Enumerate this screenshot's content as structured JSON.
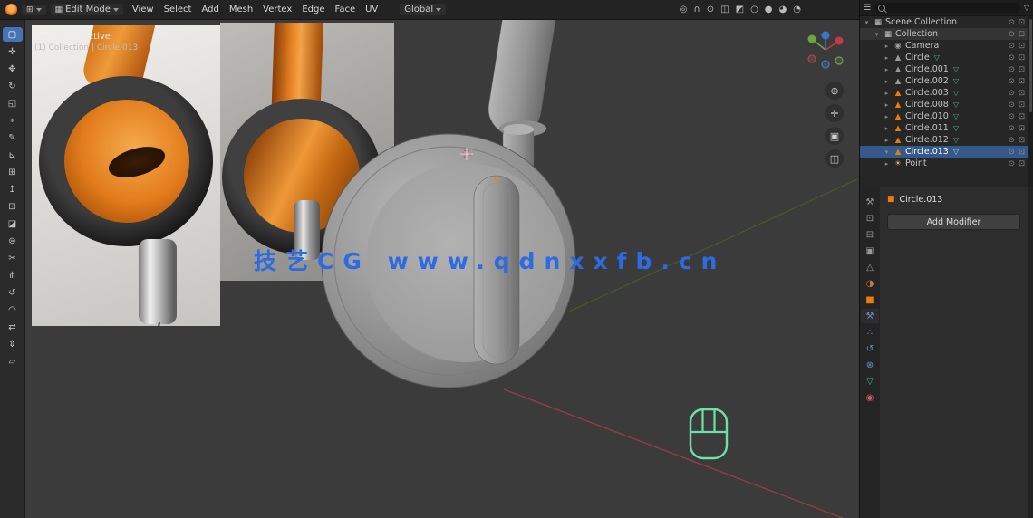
{
  "colors": {
    "accent_blue": "#4772b3",
    "selection_blue": "#35598a",
    "object_orange": "#e87d0d",
    "mesh_teal": "#43b693",
    "watermark_blue": "#2d6be3",
    "mouse_green": "#6fe0ac",
    "axis_red": "#9c3f46",
    "axis_green": "#44622a"
  },
  "header": {
    "mode_label": "Edit Mode",
    "mode_icon_glyph": "▦",
    "editor_icon_glyph": "⊞",
    "menus": [
      {
        "name": "menu-view",
        "label": "View"
      },
      {
        "name": "menu-select",
        "label": "Select"
      },
      {
        "name": "menu-add",
        "label": "Add"
      },
      {
        "name": "menu-mesh",
        "label": "Mesh"
      },
      {
        "name": "menu-vertex",
        "label": "Vertex"
      },
      {
        "name": "menu-edge",
        "label": "Edge"
      },
      {
        "name": "menu-face",
        "label": "Face"
      },
      {
        "name": "menu-uv",
        "label": "UV"
      }
    ],
    "orientation_label": "Global",
    "right_icons": [
      {
        "name": "proportional-editing-icon",
        "glyph": "◎"
      },
      {
        "name": "snap-magnet-icon",
        "glyph": "∩"
      },
      {
        "name": "pivot-point-icon",
        "glyph": "⊙"
      },
      {
        "name": "overlays-icon",
        "glyph": "◫"
      },
      {
        "name": "xray-toggle-icon",
        "glyph": "◩"
      },
      {
        "name": "shading-wireframe-icon",
        "glyph": "○"
      },
      {
        "name": "shading-solid-icon",
        "glyph": "●"
      },
      {
        "name": "shading-material-icon",
        "glyph": "◕"
      },
      {
        "name": "shading-rendered-icon",
        "glyph": "◔"
      }
    ]
  },
  "toolbar": {
    "items": [
      {
        "name": "select-box-tool",
        "glyph": "▢",
        "active": true
      },
      {
        "name": "cursor-tool",
        "glyph": "✛"
      },
      {
        "name": "move-tool",
        "glyph": "✥"
      },
      {
        "name": "rotate-tool",
        "glyph": "↻"
      },
      {
        "name": "scale-tool",
        "glyph": "◱"
      },
      {
        "name": "transform-tool",
        "glyph": "⌖"
      },
      {
        "name": "annotate-tool",
        "glyph": "✎"
      },
      {
        "name": "measure-tool",
        "glyph": "⊾"
      },
      {
        "name": "add-cube-tool",
        "glyph": "⊞"
      },
      {
        "name": "extrude-tool",
        "glyph": "↥"
      },
      {
        "name": "inset-faces-tool",
        "glyph": "⊡"
      },
      {
        "name": "bevel-tool",
        "glyph": "◪"
      },
      {
        "name": "loop-cut-tool",
        "glyph": "⊜"
      },
      {
        "name": "knife-tool",
        "glyph": "✂"
      },
      {
        "name": "poly-build-tool",
        "glyph": "⋔"
      },
      {
        "name": "spin-tool",
        "glyph": "↺"
      },
      {
        "name": "smooth-tool",
        "glyph": "◠"
      },
      {
        "name": "edge-slide-tool",
        "glyph": "⇄"
      },
      {
        "name": "shrink-fatten-tool",
        "glyph": "⇕"
      },
      {
        "name": "shear-tool",
        "glyph": "▱"
      }
    ]
  },
  "viewport": {
    "overlay_line1": "User Perspective",
    "overlay_line2": "(1) Collection | Circle.013",
    "watermark": "技艺CG www.qdnxxfb.cn",
    "nav_icons": [
      {
        "name": "zoom-icon",
        "glyph": "⊕"
      },
      {
        "name": "pan-hand-icon",
        "glyph": "✛"
      },
      {
        "name": "camera-view-icon",
        "glyph": "▣"
      },
      {
        "name": "toggle-ortho-icon",
        "glyph": "◫"
      }
    ]
  },
  "outliner": {
    "eye_glyph": "⊙",
    "screen_glyph": "⊡",
    "filter_glyph": "▽",
    "search_placeholder": "",
    "rows": [
      {
        "expand": "▾",
        "icon": "▦",
        "icon_color": "#c8c8c8",
        "label": "Scene Collection",
        "data_glyph": "",
        "indent": 0
      },
      {
        "expand": "▾",
        "icon": "▦",
        "icon_color": "#c8c8c8",
        "label": "Collection",
        "data_glyph": "",
        "indent": 1,
        "active": true
      },
      {
        "expand": "▸",
        "icon": "◉",
        "icon_color": "#9a9a9a",
        "label": "Camera",
        "data_glyph": "",
        "indent": 2
      },
      {
        "expand": "▸",
        "icon": "▲",
        "icon_color": "#9a9a9a",
        "label": "Circle",
        "data_glyph": "▽",
        "data_color": "#43b693",
        "indent": 2
      },
      {
        "expand": "▸",
        "icon": "▲",
        "icon_color": "#9a9a9a",
        "label": "Circle.001",
        "data_glyph": "▽",
        "data_color": "#43b693",
        "indent": 2
      },
      {
        "expand": "▸",
        "icon": "▲",
        "icon_color": "#9a9a9a",
        "label": "Circle.002",
        "data_glyph": "▽",
        "data_color": "#43b693",
        "indent": 2
      },
      {
        "expand": "▸",
        "icon": "▲",
        "icon_color": "#e87d0d",
        "label": "Circle.003",
        "data_glyph": "▽",
        "data_color": "#43b693",
        "indent": 2
      },
      {
        "expand": "▸",
        "icon": "▲",
        "icon_color": "#e87d0d",
        "label": "Circle.008",
        "data_glyph": "▽",
        "data_color": "#43b693",
        "indent": 2
      },
      {
        "expand": "▸",
        "icon": "▲",
        "icon_color": "#e87d0d",
        "label": "Circle.010",
        "data_glyph": "▽",
        "data_color": "#43b693",
        "indent": 2
      },
      {
        "expand": "▸",
        "icon": "▲",
        "icon_color": "#e87d0d",
        "label": "Circle.011",
        "data_glyph": "▽",
        "data_color": "#43b693",
        "indent": 2
      },
      {
        "expand": "▸",
        "icon": "▲",
        "icon_color": "#e87d0d",
        "label": "Circle.012",
        "data_glyph": "▽",
        "data_color": "#43b693",
        "indent": 2
      },
      {
        "expand": "▾",
        "icon": "▲",
        "icon_color": "#e87d0d",
        "label": "Circle.013",
        "data_glyph": "▽",
        "data_color": "#9fd8c4",
        "indent": 2,
        "selected": true
      },
      {
        "expand": "▸",
        "icon": "☀",
        "icon_color": "#e8b34b",
        "label": "Point",
        "data_glyph": "",
        "indent": 2
      }
    ]
  },
  "properties": {
    "object_icon_glyph": "■",
    "object_name": "Circle.013",
    "add_modifier_label": "Add Modifier",
    "tabs": [
      {
        "name": "tab-tool",
        "glyph": "⚒",
        "color": "#9a9a9a"
      },
      {
        "name": "tab-render",
        "glyph": "⊡",
        "color": "#9a9a9a"
      },
      {
        "name": "tab-output",
        "glyph": "⊟",
        "color": "#9a9a9a"
      },
      {
        "name": "tab-view-layer",
        "glyph": "▣",
        "color": "#9a9a9a"
      },
      {
        "name": "tab-scene",
        "glyph": "△",
        "color": "#9a9a9a"
      },
      {
        "name": "tab-world",
        "glyph": "◑",
        "color": "#c07a4a"
      },
      {
        "name": "tab-object",
        "glyph": "■",
        "color": "#e87d0d"
      },
      {
        "name": "tab-modifiers",
        "glyph": "⚒",
        "color": "#6f8fc8",
        "active": true
      },
      {
        "name": "tab-particles",
        "glyph": "∴",
        "color": "#6f8fc8"
      },
      {
        "name": "tab-physics",
        "glyph": "↺",
        "color": "#6f8fc8"
      },
      {
        "name": "tab-constraints",
        "glyph": "⊗",
        "color": "#6f8fc8"
      },
      {
        "name": "tab-object-data",
        "glyph": "▽",
        "color": "#43b693"
      },
      {
        "name": "tab-material",
        "glyph": "◉",
        "color": "#d0566b"
      }
    ]
  }
}
